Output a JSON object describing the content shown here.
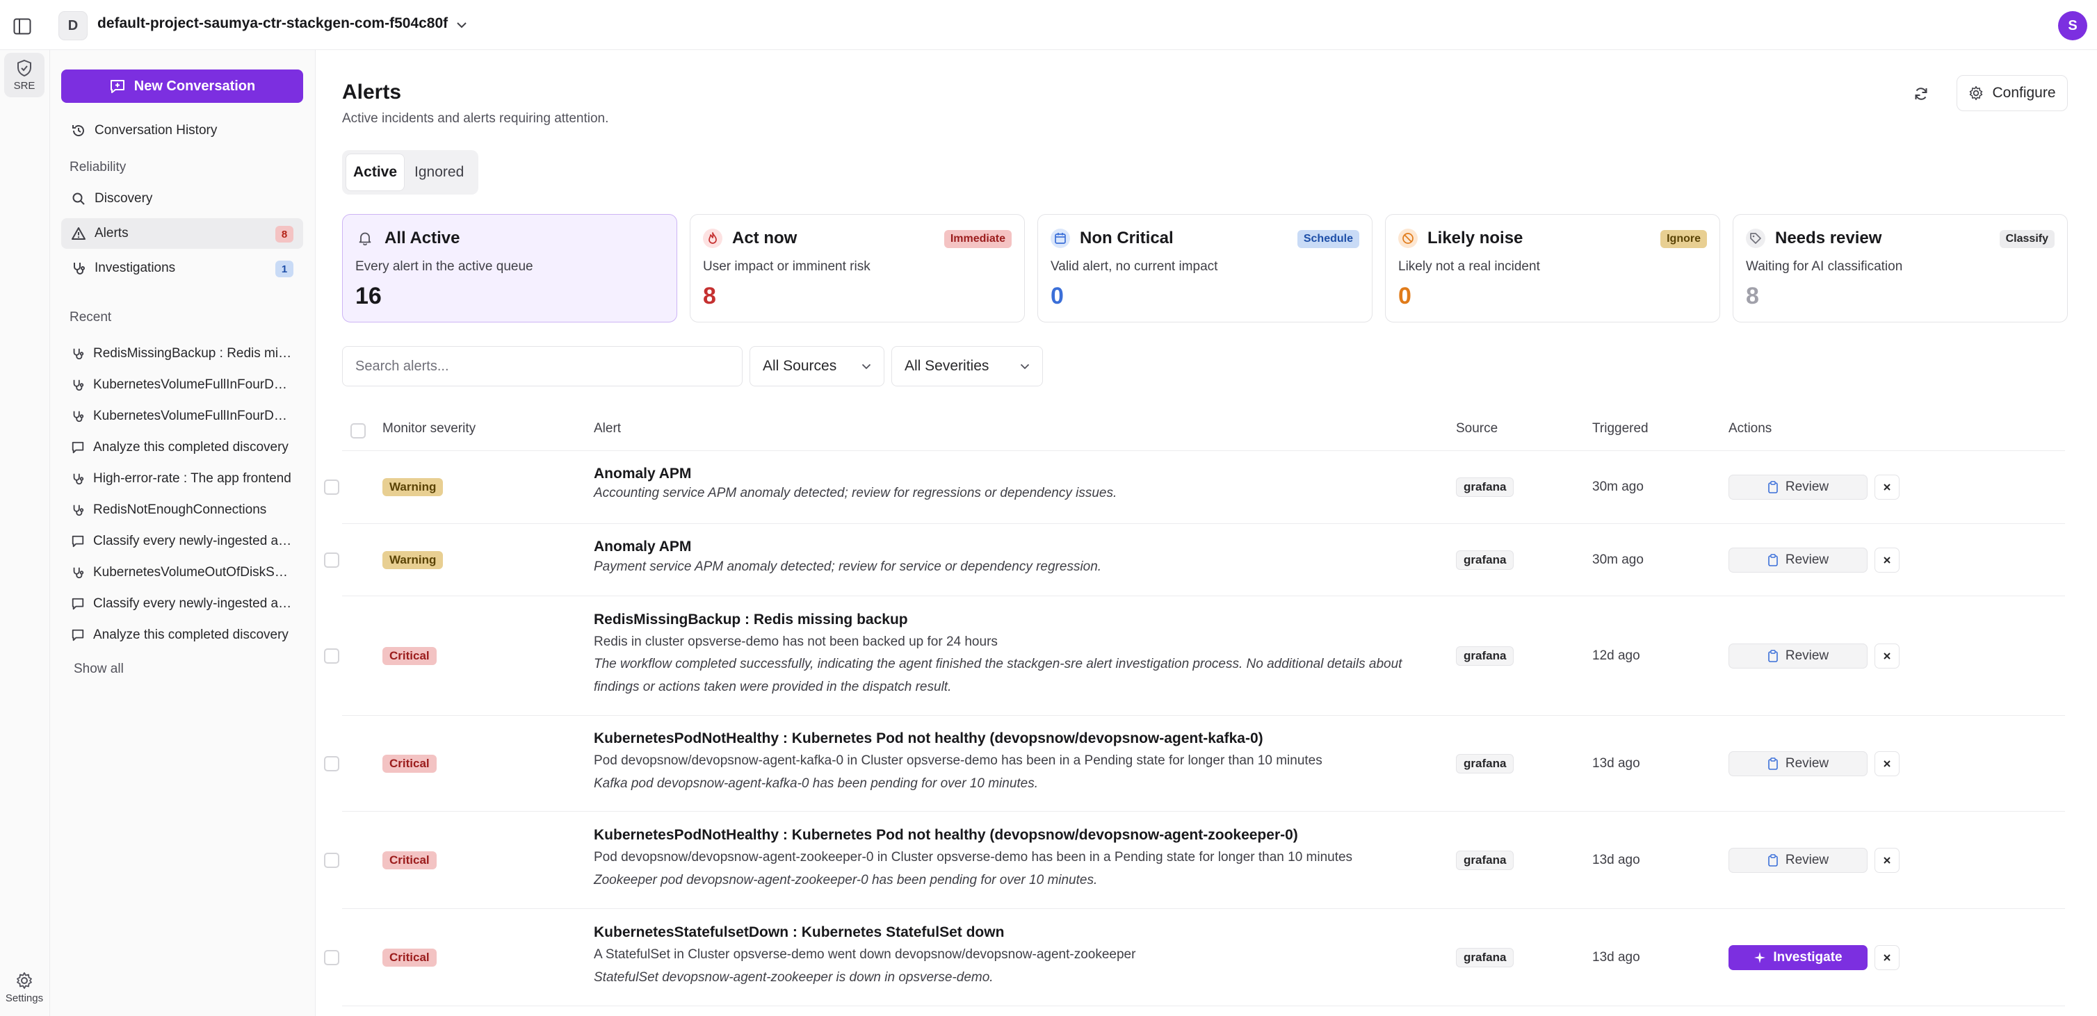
{
  "project": {
    "initial": "D",
    "name": "default-project-saumya-ctr-stackgen-com-f504c80f"
  },
  "user": {
    "initial": "S"
  },
  "rail": {
    "sre_label": "SRE",
    "settings_label": "Settings"
  },
  "sidebar": {
    "new_conversation": "New Conversation",
    "history": "Conversation History",
    "section_reliability": "Reliability",
    "nav": [
      {
        "label": "Discovery"
      },
      {
        "label": "Alerts",
        "badge": "8"
      },
      {
        "label": "Investigations",
        "badge": "1"
      }
    ],
    "section_recent": "Recent",
    "recent": [
      "RedisMissingBackup : Redis missing backup",
      "KubernetesVolumeFullInFourDays",
      "KubernetesVolumeFullInFourDays",
      "Analyze this completed discovery",
      "High-error-rate : The app frontend",
      "RedisNotEnoughConnections",
      "Classify every newly-ingested alert",
      "KubernetesVolumeOutOfDiskSpace",
      "Classify every newly-ingested alert",
      "Analyze this completed discovery"
    ],
    "show_all": "Show all"
  },
  "header": {
    "title": "Alerts",
    "subtitle": "Active incidents and alerts requiring attention.",
    "configure": "Configure"
  },
  "tabs": [
    "Active",
    "Ignored"
  ],
  "cards": [
    {
      "title": "All Active",
      "desc": "Every alert in the active queue",
      "count": "16",
      "tag": ""
    },
    {
      "title": "Act now",
      "desc": "User impact or imminent risk",
      "count": "8",
      "tag": "Immediate"
    },
    {
      "title": "Non Critical",
      "desc": "Valid alert, no current impact",
      "count": "0",
      "tag": "Schedule"
    },
    {
      "title": "Likely noise",
      "desc": "Likely not a real incident",
      "count": "0",
      "tag": "Ignore"
    },
    {
      "title": "Needs review",
      "desc": "Waiting for AI classification",
      "count": "8",
      "tag": "Classify"
    }
  ],
  "filters": {
    "search_placeholder": "Search alerts...",
    "sources": "All Sources",
    "severities": "All Severities"
  },
  "table": {
    "headers": {
      "severity": "Monitor severity",
      "alert": "Alert",
      "source": "Source",
      "triggered": "Triggered",
      "actions": "Actions"
    },
    "rows": [
      {
        "severity": "Warning",
        "title": "Anomaly APM",
        "desc": "",
        "note": "Accounting service APM anomaly detected; review for regressions or dependency issues.",
        "source": "grafana",
        "triggered": "30m ago",
        "action": "Review"
      },
      {
        "severity": "Warning",
        "title": "Anomaly APM",
        "desc": "",
        "note": "Payment service APM anomaly detected; review for service or dependency regression.",
        "source": "grafana",
        "triggered": "30m ago",
        "action": "Review"
      },
      {
        "severity": "Critical",
        "title": "RedisMissingBackup : Redis missing backup",
        "desc": "Redis in cluster opsverse-demo has not been backed up for 24 hours",
        "note": "The workflow completed successfully, indicating the agent finished the stackgen-sre alert investigation process. No additional details about findings or actions taken were provided in the dispatch result.",
        "source": "grafana",
        "triggered": "12d ago",
        "action": "Review"
      },
      {
        "severity": "Critical",
        "title": "KubernetesPodNotHealthy : Kubernetes Pod not healthy (devopsnow/devopsnow-agent-kafka-0)",
        "desc": "Pod devopsnow/devopsnow-agent-kafka-0 in Cluster opsverse-demo has been in a Pending state for longer than 10 minutes",
        "note": "Kafka pod devopsnow-agent-kafka-0 has been pending for over 10 minutes.",
        "source": "grafana",
        "triggered": "13d ago",
        "action": "Review"
      },
      {
        "severity": "Critical",
        "title": "KubernetesPodNotHealthy : Kubernetes Pod not healthy (devopsnow/devopsnow-agent-zookeeper-0)",
        "desc": "Pod devopsnow/devopsnow-agent-zookeeper-0 in Cluster opsverse-demo has been in a Pending state for longer than 10 minutes",
        "note": "Zookeeper pod devopsnow-agent-zookeeper-0 has been pending for over 10 minutes.",
        "source": "grafana",
        "triggered": "13d ago",
        "action": "Review"
      },
      {
        "severity": "Critical",
        "title": "KubernetesStatefulsetDown : Kubernetes StatefulSet down",
        "desc": "A StatefulSet in Cluster opsverse-demo went down devopsnow/devopsnow-agent-zookeeper",
        "note": "StatefulSet devopsnow-agent-zookeeper is down in opsverse-demo.",
        "source": "grafana",
        "triggered": "13d ago",
        "action": "Investigate"
      }
    ]
  },
  "colors": {
    "accent": "#7c2fe0",
    "critical": "#c53030",
    "info": "#3b6fd8",
    "noise": "#e07b1a",
    "muted": "#a1a1aa"
  }
}
